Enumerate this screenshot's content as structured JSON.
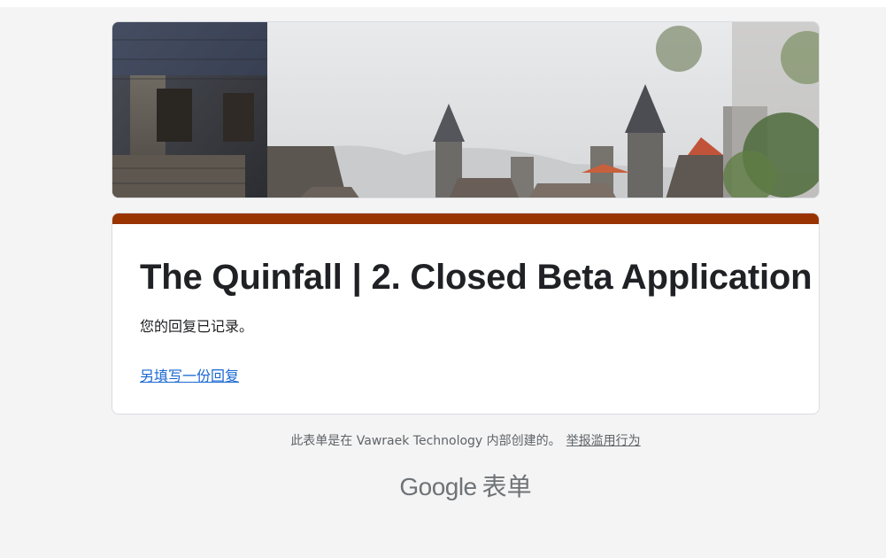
{
  "form": {
    "title": "The Quinfall | 2. Closed Beta Application",
    "confirmation_message": "您的回复已记录。",
    "submit_another_link": "另填写一份回复",
    "accent_color": "#993300",
    "header_image_icon": "castle-town-banner-image"
  },
  "footer": {
    "created_by_text": "此表单是在 Vawraek Technology 内部创建的。",
    "report_abuse_link": "举报滥用行为",
    "brand_google": "Google",
    "brand_forms": "表单"
  }
}
